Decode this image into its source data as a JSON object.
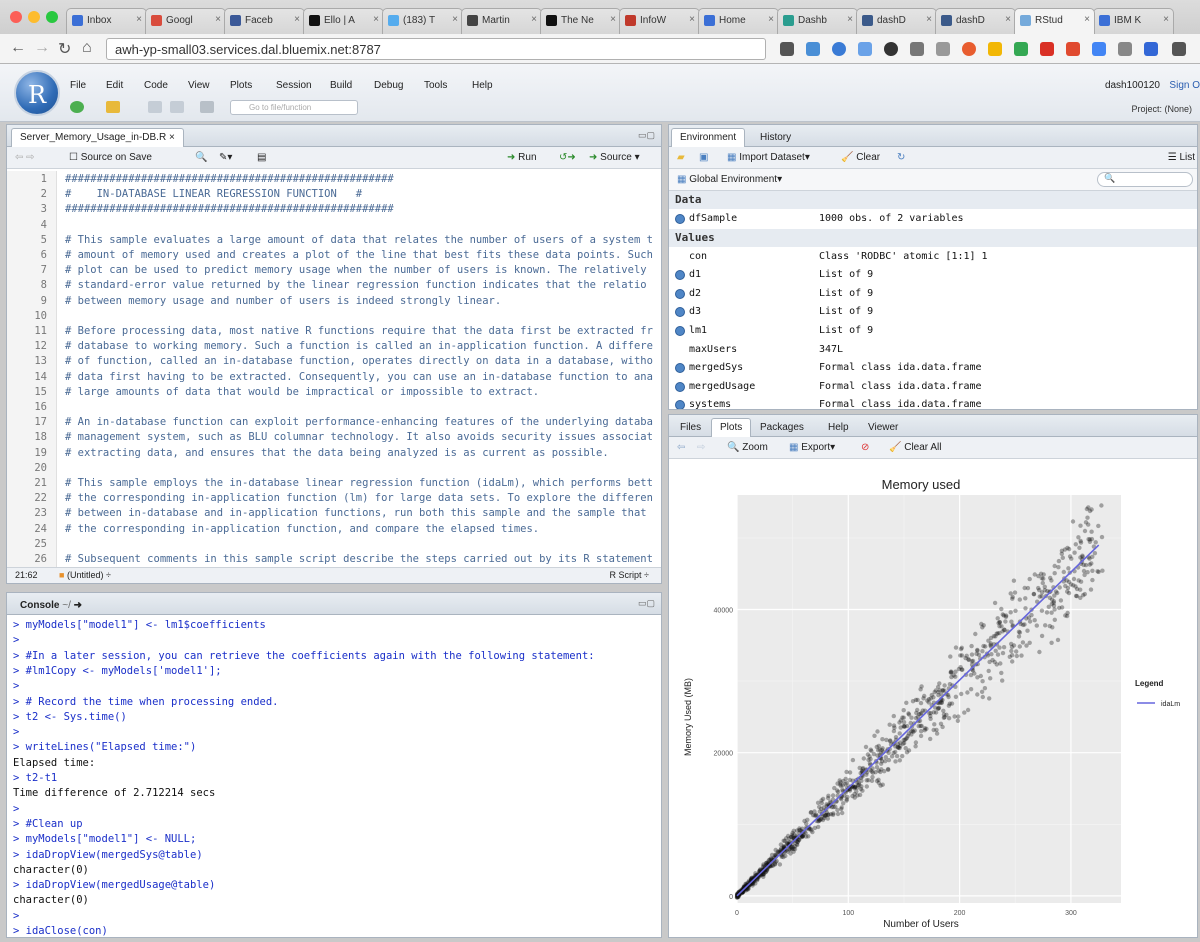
{
  "browser": {
    "tabs": [
      {
        "label": "Inbox",
        "color": "#3b6fd6"
      },
      {
        "label": "Googl",
        "color": "#d94c3d"
      },
      {
        "label": "Faceb",
        "color": "#3b5998"
      },
      {
        "label": "Ello | A",
        "color": "#111111"
      },
      {
        "label": "(183) T",
        "color": "#55acee"
      },
      {
        "label": "Martin",
        "color": "#444444"
      },
      {
        "label": "The Ne",
        "color": "#111111"
      },
      {
        "label": "InfoW",
        "color": "#c0392b"
      },
      {
        "label": "Home",
        "color": "#3b6fd6"
      },
      {
        "label": "Dashb",
        "color": "#2a9d8f"
      },
      {
        "label": "dashD",
        "color": "#3b5a8a"
      },
      {
        "label": "dashD",
        "color": "#3b5a8a"
      },
      {
        "label": "RStud",
        "color": "#75aadb"
      },
      {
        "label": "IBM K",
        "color": "#3b6fd6"
      }
    ],
    "url": "awh-yp-small03.services.dal.bluemix.net:8787"
  },
  "rstudio": {
    "logo": "R",
    "menu": [
      "File",
      "Edit",
      "Code",
      "View",
      "Plots",
      "Session",
      "Build",
      "Debug",
      "Tools",
      "Help"
    ],
    "user": "dash100120",
    "signout": "Sign O",
    "project": "Project: (None)",
    "goto_placeholder": "Go to file/function"
  },
  "editor": {
    "tab": "Server_Memory_Usage_in-DB.R",
    "source_on_save": "Source on Save",
    "run": "Run",
    "source": "Source",
    "lines": [
      {
        "n": "1",
        "t": "####################################################"
      },
      {
        "n": "2",
        "t": "#    IN-DATABASE LINEAR REGRESSION FUNCTION   #"
      },
      {
        "n": "3",
        "t": "####################################################"
      },
      {
        "n": "4",
        "t": ""
      },
      {
        "n": "5",
        "t": "# This sample evaluates a large amount of data that relates the number of users of a system t"
      },
      {
        "n": "6",
        "t": "# amount of memory used and creates a plot of the line that best fits these data points. Such"
      },
      {
        "n": "7",
        "t": "# plot can be used to predict memory usage when the number of users is known. The relatively"
      },
      {
        "n": "8",
        "t": "# standard-error value returned by the linear regression function indicates that the relatio"
      },
      {
        "n": "9",
        "t": "# between memory usage and number of users is indeed strongly linear."
      },
      {
        "n": "10",
        "t": ""
      },
      {
        "n": "11",
        "t": "# Before processing data, most native R functions require that the data first be extracted fr"
      },
      {
        "n": "12",
        "t": "# database to working memory. Such a function is called an in-application function. A differe"
      },
      {
        "n": "13",
        "t": "# of function, called an in-database function, operates directly on data in a database, witho"
      },
      {
        "n": "14",
        "t": "# data first having to be extracted. Consequently, you can use an in-database function to ana"
      },
      {
        "n": "15",
        "t": "# large amounts of data that would be impractical or impossible to extract."
      },
      {
        "n": "16",
        "t": ""
      },
      {
        "n": "17",
        "t": "# An in-database function can exploit performance-enhancing features of the underlying databa"
      },
      {
        "n": "18",
        "t": "# management system, such as BLU columnar technology. It also avoids security issues associat"
      },
      {
        "n": "19",
        "t": "# extracting data, and ensures that the data being analyzed is as current as possible."
      },
      {
        "n": "20",
        "t": ""
      },
      {
        "n": "21",
        "t": "# This sample employs the in-database linear regression function (idaLm), which performs bett"
      },
      {
        "n": "22",
        "t": "# the corresponding in-application function (lm) for large data sets. To explore the differen"
      },
      {
        "n": "23",
        "t": "# between in-database and in-application functions, run both this sample and the sample that"
      },
      {
        "n": "24",
        "t": "# the corresponding in-application function, and compare the elapsed times."
      },
      {
        "n": "25",
        "t": ""
      },
      {
        "n": "26",
        "t": "# Subsequent comments in this sample script describe the steps carried out by its R statement"
      }
    ],
    "status_pos": "21:62",
    "status_scope": "(Untitled)",
    "status_type": "R Script"
  },
  "console": {
    "title": "Console",
    "path": "~/",
    "lines": [
      {
        "t": "> myModels[\"model1\"] <- lm1$coefficients",
        "k": "cmd"
      },
      {
        "t": ">",
        "k": "cmd"
      },
      {
        "t": "> #In a later session, you can retrieve the coefficients again with the following statement:",
        "k": "cmd"
      },
      {
        "t": "> #lm1Copy <- myModels['model1'];",
        "k": "cmd"
      },
      {
        "t": ">",
        "k": "cmd"
      },
      {
        "t": "> # Record the time when processing ended.",
        "k": "cmd"
      },
      {
        "t": "> t2 <- Sys.time()",
        "k": "cmd"
      },
      {
        "t": ">",
        "k": "cmd"
      },
      {
        "t": "> writeLines(\"Elapsed time:\")",
        "k": "cmd"
      },
      {
        "t": "Elapsed time:",
        "k": "out"
      },
      {
        "t": "> t2-t1",
        "k": "cmd"
      },
      {
        "t": "Time difference of 2.712214 secs",
        "k": "out"
      },
      {
        "t": ">",
        "k": "cmd"
      },
      {
        "t": "> #Clean up",
        "k": "cmd"
      },
      {
        "t": "> myModels[\"model1\"] <- NULL;",
        "k": "cmd"
      },
      {
        "t": "> idaDropView(mergedSys@table)",
        "k": "cmd"
      },
      {
        "t": "character(0)",
        "k": "out"
      },
      {
        "t": "> idaDropView(mergedUsage@table)",
        "k": "cmd"
      },
      {
        "t": "character(0)",
        "k": "out"
      },
      {
        "t": ">",
        "k": "cmd"
      },
      {
        "t": "> idaClose(con)",
        "k": "cmd"
      }
    ]
  },
  "environment": {
    "tabs": [
      "Environment",
      "History"
    ],
    "import": "Import Dataset",
    "clear": "Clear",
    "list": "List",
    "scope": "Global Environment",
    "data_header": "Data",
    "values_header": "Values",
    "data_rows": [
      {
        "name": "dfSample",
        "value": "1000 obs. of 2 variables",
        "dot": true
      }
    ],
    "value_rows": [
      {
        "name": "con",
        "value": "Class 'RODBC' atomic [1:1] 1",
        "dot": false
      },
      {
        "name": "d1",
        "value": "List of 9",
        "dot": true
      },
      {
        "name": "d2",
        "value": "List of 9",
        "dot": true
      },
      {
        "name": "d3",
        "value": "List of 9",
        "dot": true
      },
      {
        "name": "lm1",
        "value": "List of 9",
        "dot": true
      },
      {
        "name": "maxUsers",
        "value": "347L",
        "dot": false
      },
      {
        "name": "mergedSys",
        "value": "Formal class ida.data.frame",
        "dot": true
      },
      {
        "name": "mergedUsage",
        "value": "Formal class ida.data.frame",
        "dot": true
      },
      {
        "name": "systems",
        "value": "Formal class ida.data.frame",
        "dot": true
      }
    ]
  },
  "files": {
    "tabs": [
      "Files",
      "Plots",
      "Packages",
      "Help",
      "Viewer"
    ],
    "zoom": "Zoom",
    "export": "Export",
    "clear_all": "Clear All"
  },
  "chart_data": {
    "type": "scatter",
    "title": "Memory used",
    "xlabel": "Number of Users",
    "ylabel": "Memory Used (MB)",
    "xlim": [
      0,
      345
    ],
    "ylim": [
      -1000,
      56000
    ],
    "xticks": [
      0,
      100,
      200,
      300
    ],
    "yticks": [
      0,
      20000,
      40000
    ],
    "legend_title": "Legend",
    "series": [
      {
        "name": "idaLm",
        "type": "line",
        "color": "#6666dd",
        "x": [
          0,
          325
        ],
        "y": [
          0,
          49000
        ]
      }
    ],
    "points": {
      "description_n": 1000,
      "slope": 150,
      "color": "#111111"
    },
    "grid": true,
    "legend_position": "right"
  }
}
